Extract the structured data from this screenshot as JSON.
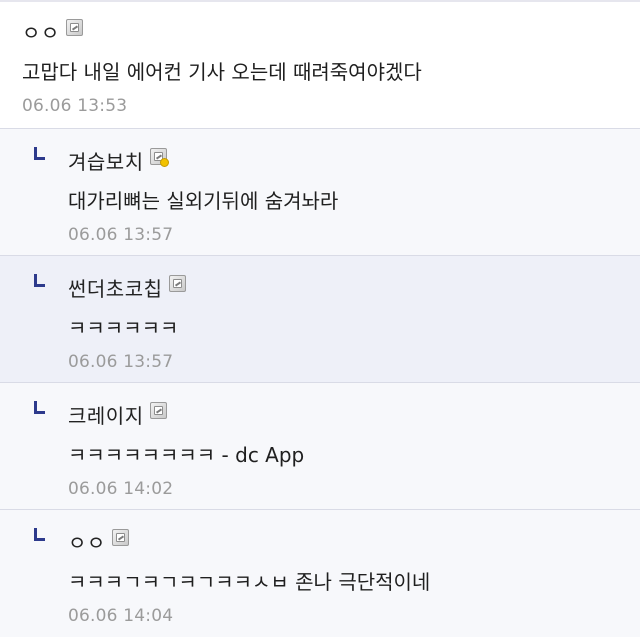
{
  "comments": [
    {
      "nickname": "ㅇㅇ",
      "icon": "fixed-nick-icon",
      "text": "고맙다 내일 에어컨 기사 오는데 때려죽여야겠다",
      "time": "06.06 13:53"
    },
    {
      "nickname": "겨습보치",
      "icon": "fixed-nick-icon-flagged",
      "text": "대가리뼈는 실외기뒤에 숨겨놔라",
      "time": "06.06 13:57"
    },
    {
      "nickname": "썬더초코칩",
      "icon": "fixed-nick-icon",
      "text": "ㅋㅋㅋㅋㅋㅋ",
      "time": "06.06 13:57"
    },
    {
      "nickname": "크레이지",
      "icon": "fixed-nick-icon",
      "text": "ㅋㅋㅋㅋㅋㅋㅋㅋ - dc App",
      "time": "06.06 14:02"
    },
    {
      "nickname": "ㅇㅇ",
      "icon": "fixed-nick-icon",
      "text": "ㅋㅋㅋㄱㅋㄱㅋㄱㅋㅋㅅㅂ 존나 극단적이네",
      "time": "06.06 14:04"
    }
  ]
}
